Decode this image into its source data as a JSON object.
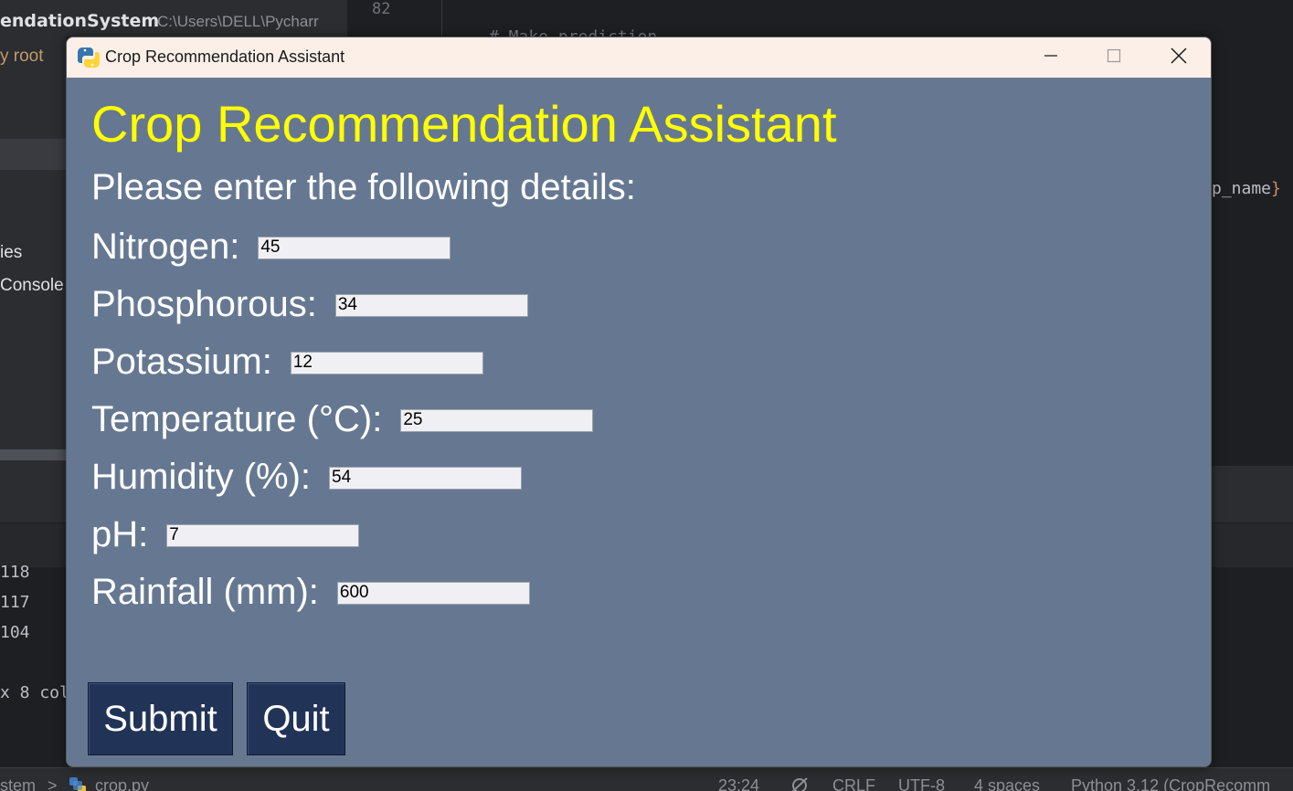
{
  "ide": {
    "project_title": "endationSystem",
    "project_path": "C:\\Users\\DELL\\Pycharr",
    "line_number": "82",
    "code_comment": "# Make prediction",
    "root_label": "y root",
    "tree_items": [
      "ies",
      "Console"
    ],
    "console_lines": [
      "118",
      "117",
      "104",
      "x 8 col"
    ],
    "right_code_text": "p_name",
    "right_code_brace": "}",
    "status": {
      "breadcrumb_left": "stem",
      "breadcrumb_sep": ">",
      "file": "crop.py",
      "position": "23:24",
      "line_ending": "CRLF",
      "encoding": "UTF-8",
      "indent": "4 spaces",
      "interpreter": "Python 3.12 (CropRecomm"
    }
  },
  "window": {
    "title": "Crop Recommendation Assistant",
    "accent": "#667891",
    "controls": {
      "minimize": "minimize-icon",
      "maximize": "maximize-icon",
      "close": "close-icon"
    }
  },
  "app": {
    "heading": "Crop Recommendation Assistant",
    "heading_color": "#ffff00",
    "subtitle": "Please enter the following details:",
    "fields": [
      {
        "label": "Nitrogen:",
        "value": "45"
      },
      {
        "label": "Phosphorous:",
        "value": "34"
      },
      {
        "label": "Potassium:",
        "value": "12"
      },
      {
        "label": "Temperature (°C):",
        "value": "25"
      },
      {
        "label": "Humidity (%):",
        "value": "54"
      },
      {
        "label": "pH:",
        "value": "7"
      },
      {
        "label": "Rainfall (mm):",
        "value": "600"
      }
    ],
    "buttons": {
      "submit": "Submit",
      "quit": "Quit"
    },
    "button_color": "#213457"
  }
}
